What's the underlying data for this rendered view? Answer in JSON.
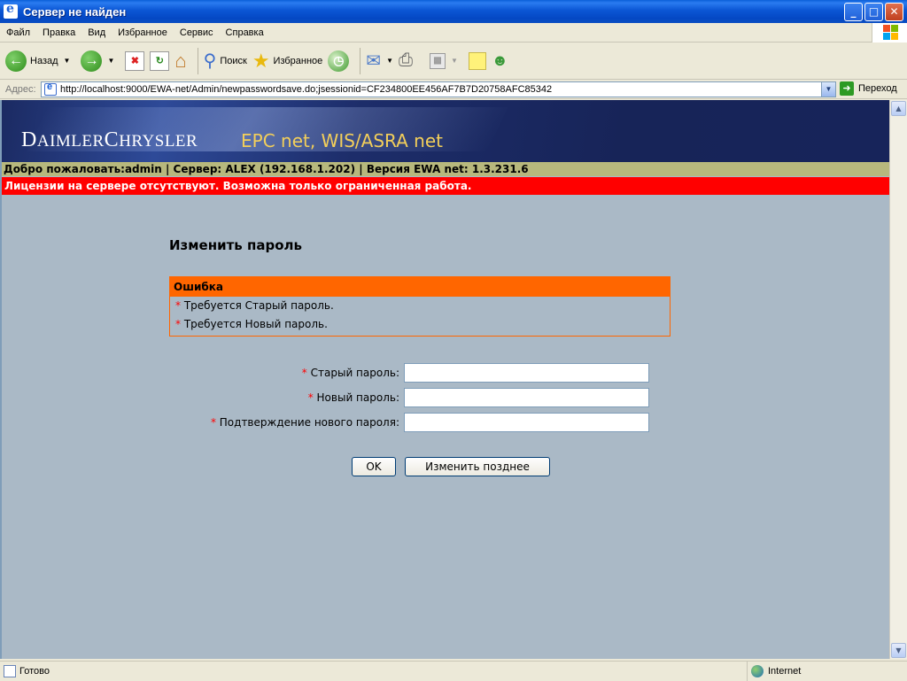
{
  "window": {
    "title": "Сервер не найден",
    "minimize": "_",
    "maximize": "□",
    "close": "✕"
  },
  "menu": [
    "Файл",
    "Правка",
    "Вид",
    "Избранное",
    "Сервис",
    "Справка"
  ],
  "toolbar": {
    "back_label": "Назад",
    "search_label": "Поиск",
    "favorites_label": "Избранное"
  },
  "address": {
    "label": "Адрес:",
    "url": "http://localhost:9000/EWA-net/Admin/newpasswordsave.do;jsessionid=CF234800EE456AF7B7D20758AFC85342",
    "go_label": "Переход"
  },
  "banner": {
    "brand_first_cap": "D",
    "brand_first_rest": "AIMLER",
    "brand_second_cap": "C",
    "brand_second_rest": "HRYSLER",
    "product": "EPC net, WIS/ASRA net"
  },
  "info_bar": "Добро пожаловать:admin | Сервер: ALEX (192.168.1.202) | Версия EWA net: 1.3.231.6",
  "license_bar": "Лицензии на сервере отсутствуют. Возможна только ограниченная работа.",
  "form": {
    "title": "Изменить пароль",
    "error_header": "Ошибка",
    "errors": [
      "Требуется Старый пароль.",
      "Требуется Новый пароль."
    ],
    "required_mark": "*",
    "old_password_label": "Старый пароль:",
    "new_password_label": "Новый пароль:",
    "confirm_password_label": "Подтверждение нового пароля:",
    "ok_button": "OK",
    "later_button": "Изменить позднее"
  },
  "status": {
    "text": "Готово",
    "zone": "Internet"
  }
}
